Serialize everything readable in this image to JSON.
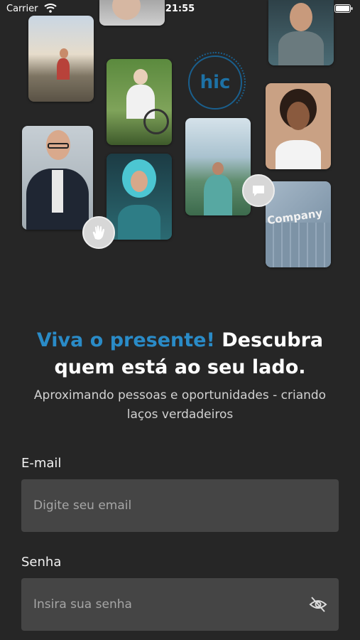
{
  "status_bar": {
    "carrier": "Carrier",
    "time": "21:55"
  },
  "logo": {
    "text": "hic"
  },
  "collage": {
    "company_sign": "Company"
  },
  "headline": {
    "accent": "Viva o presente!",
    "rest": "Descubra quem está ao seu lado."
  },
  "subtitle": "Aproximando pessoas e oportunidades - criando laços verdadeiros",
  "form": {
    "email_label": "E-mail",
    "email_placeholder": "Digite seu email",
    "password_label": "Senha",
    "password_placeholder": "Insira sua senha"
  },
  "colors": {
    "accent": "#2a8bc7",
    "background": "#262626",
    "field": "#454545"
  },
  "icons": [
    "wifi-icon",
    "battery-icon",
    "hand-wave-icon",
    "chat-icon",
    "eye-off-icon"
  ]
}
